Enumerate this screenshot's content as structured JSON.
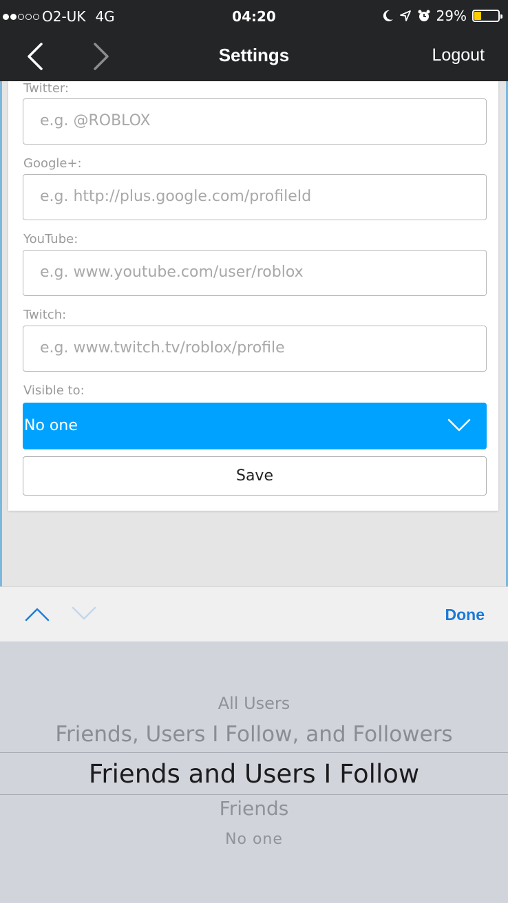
{
  "status_bar": {
    "carrier": "O2-UK",
    "network": "4G",
    "time": "04:20",
    "battery": "29%",
    "battery_level": 0.29,
    "battery_color": "#ffcc00",
    "icons": [
      "moon-icon",
      "location-arrow-icon",
      "alarm-icon",
      "battery-icon"
    ]
  },
  "nav": {
    "title": "Settings",
    "logout_label": "Logout",
    "back_icon": "chevron-left-icon",
    "forward_icon": "chevron-right-icon"
  },
  "form": {
    "fields": [
      {
        "label": "Twitter:",
        "placeholder": "e.g. @ROBLOX",
        "value": ""
      },
      {
        "label": "Google+:",
        "placeholder": "e.g. http://plus.google.com/profileId",
        "value": ""
      },
      {
        "label": "YouTube:",
        "placeholder": "e.g. www.youtube.com/user/roblox",
        "value": ""
      },
      {
        "label": "Twitch:",
        "placeholder": "e.g. www.twitch.tv/roblox/profile",
        "value": ""
      }
    ],
    "visible_to_label": "Visible to:",
    "visible_to_value": "No one",
    "accent_color": "#00a2ff",
    "save_label": "Save"
  },
  "picker_toolbar": {
    "done_label": "Done",
    "accent_color": "#1a7ad9"
  },
  "picker": {
    "options": [
      "All Users",
      "Friends, Users I Follow, and Followers",
      "Friends and Users I Follow",
      "Friends",
      "No one"
    ],
    "selected": "Friends and Users I Follow"
  }
}
